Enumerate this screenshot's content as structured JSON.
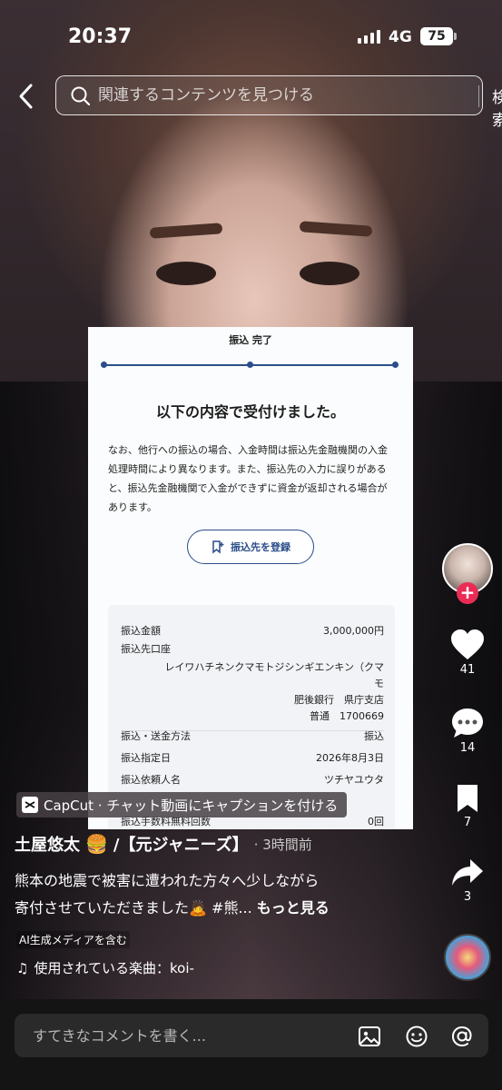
{
  "status": {
    "time": "20:37",
    "network": "4G",
    "battery": "75"
  },
  "search": {
    "placeholder": "関連するコンテンツを見つける",
    "button": "検索"
  },
  "card": {
    "title": "振込 完了",
    "heading": "以下の内容で受付けました。",
    "note": "なお、他行への振込の場合、入金時間は振込先金融機関の入金処理時間により異なります。また、振込先の入力に誤りがあると、振込先金融機関で入金ができずに資金が返却される場合があります。",
    "register_button": "振込先を登録",
    "amount_label": "振込金額",
    "amount_value": "3,000,000円",
    "account_label": "振込先口座",
    "account_line1": "レイワハチネンクマモトジシンギエンキン（クマ",
    "account_line2": "モ",
    "account_line3": "肥後銀行　県庁支店",
    "account_line4": "普通　1700669",
    "method_label": "振込・送金方法",
    "method_value": "振込",
    "date_label": "振込指定日",
    "date_value": "2026年8月3日",
    "requester_label": "振込依頼人名",
    "requester_value": "ツチヤユウタ",
    "fee_label": "振込手数料無料回数",
    "fee_value": "0回"
  },
  "capcut": {
    "label": "CapCut · チャット動画にキャプションを付ける"
  },
  "author": {
    "name": "土屋悠太",
    "suffix": "/【元ジャニーズ】",
    "time": "· 3時間前"
  },
  "caption": {
    "line1": "熊本の地震で被害に遭われた方々へ少しながら",
    "line2": "寄付させていただきました",
    "line2_tail": "#熊...",
    "more": "もっと見る"
  },
  "ai_badge": "AI生成メディアを含む",
  "music": {
    "label": "使用されている楽曲：koi-"
  },
  "actions": {
    "likes": "41",
    "comments": "14",
    "saves": "7",
    "shares": "3"
  },
  "comment": {
    "placeholder": "すてきなコメントを書く..."
  },
  "colors": {
    "accent": "#ea2c55",
    "bank_blue": "#2b4d8a"
  }
}
